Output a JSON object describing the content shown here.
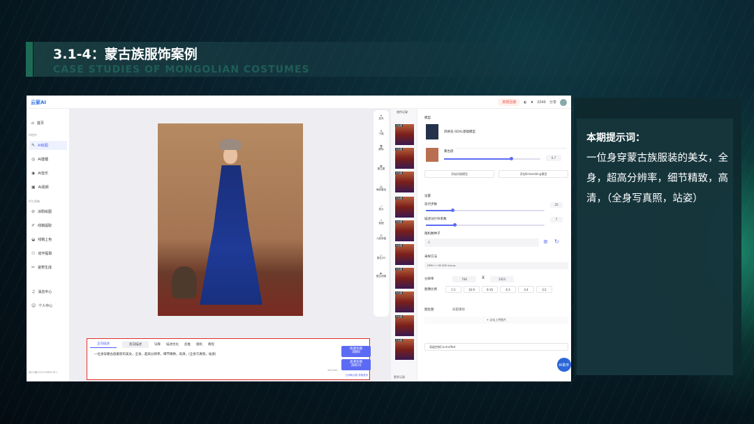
{
  "slide": {
    "title_cn": "3.1-4：蒙古族服饰案例",
    "title_en": "CASE STUDIES OF MONGOLIAN COSTUMES"
  },
  "app": {
    "logo": "云家AI",
    "header": {
      "promo": "真根回春",
      "credits": "2046",
      "share": "分享"
    },
    "sidebar": {
      "home": "首页",
      "section_create": "AI创作",
      "draw": "AI绘图",
      "model": "AI建模",
      "music": "AI音乐",
      "video": "AI视频",
      "section_tools": "AI工具箱",
      "roam": "涂鸦绘图",
      "sketch_lines": "线稿提取",
      "color": "线稿上色",
      "motion": "动作提取",
      "pose": "姿势生成",
      "messages": "消息中心",
      "profile": "个人中心",
      "footer": "浙ICP备2023036881号-2"
    },
    "toolstrip": [
      [
        "发布"
      ],
      [
        "下载"
      ],
      [
        "删除"
      ],
      [
        "图生图"
      ],
      [
        "局部重绘"
      ],
      [
        "放大"
      ],
      [
        "抠图"
      ],
      [
        "人脸修复"
      ],
      [
        "图生3D"
      ],
      [
        "图生视频"
      ]
    ],
    "prompt": {
      "tab_pos": "正向描述",
      "tab_neg": "反向描述",
      "t1": "词库",
      "t2": "描述优化",
      "t3": "反推",
      "t4": "随机",
      "t5": "教程",
      "text": "一位身穿蒙古族服装的美女，全身，超高分辨率，细节精致，高清，(全身写真照，站姿)",
      "count": "46/2000",
      "fast_btn": "快速生图",
      "fast_sub": "消耗8",
      "hq_btn": "高清生图",
      "hq_sub": "消耗16",
      "foot": "已消耗点数 获取更多"
    },
    "history": {
      "title": "创作记录",
      "tag": "文生图",
      "more": "更多记录"
    },
    "right": {
      "model_label": "模型",
      "model_name": "风格化-SDXL基础模型",
      "lora": "蒙古族",
      "lora_val": "0.7",
      "add_style": "添加风格模型",
      "add_emb": "添加Embedding模型",
      "settings": "设置",
      "steps": "迭代步数",
      "steps_val": "20",
      "cfg": "描述词引导系数",
      "cfg_val": "7",
      "seed": "随机数种子",
      "seed_val": "-1",
      "sampler": "采样方法",
      "sampler_val": "DPM++ 2M SDE Karras",
      "res": "分辨率",
      "w": "768",
      "x": "X",
      "h": "1024",
      "ratio": "图像比例",
      "ratios": [
        "1:1",
        "16:9",
        "9:16",
        "4:3",
        "3:4",
        "3:2"
      ],
      "img2img": "图生图",
      "partial": "局部重绘",
      "upload": "+ 点击上传图片",
      "cnet": "高级控制ControlNet",
      "bot": "AI助手"
    }
  },
  "card": {
    "title": "本期提示词：",
    "body": "一位身穿蒙古族服装的美女，全身，超高分辨率，细节精致，高清，（全身写真照，站姿）"
  }
}
